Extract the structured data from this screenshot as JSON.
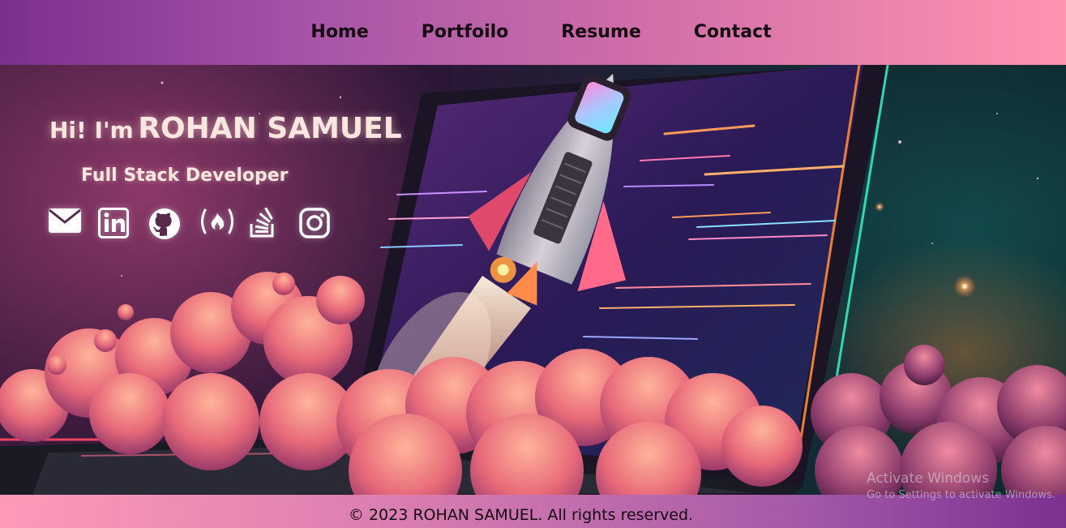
{
  "nav": {
    "items": [
      {
        "label": "Home"
      },
      {
        "label": "Portfoilo"
      },
      {
        "label": "Resume"
      },
      {
        "label": "Contact"
      }
    ]
  },
  "hero": {
    "greeting": "Hi! I'm",
    "name": "ROHAN SAMUEL",
    "role": "Full Stack Developer",
    "socials": [
      {
        "icon": "email-icon"
      },
      {
        "icon": "linkedin-icon"
      },
      {
        "icon": "github-icon"
      },
      {
        "icon": "freecodecamp-icon"
      },
      {
        "icon": "stackoverflow-icon"
      },
      {
        "icon": "instagram-icon"
      }
    ]
  },
  "footer": {
    "copyright": "© 2023 ROHAN SAMUEL. All rights reserved."
  },
  "system": {
    "watermark_title": "Activate Windows",
    "watermark_subtitle": "Go to Settings to activate Windows."
  },
  "colors": {
    "nav_gradient_start": "#7b2f8e",
    "nav_gradient_end": "#ff93b0",
    "text_dark": "#150a12",
    "hero_text": "#fbe7df"
  }
}
